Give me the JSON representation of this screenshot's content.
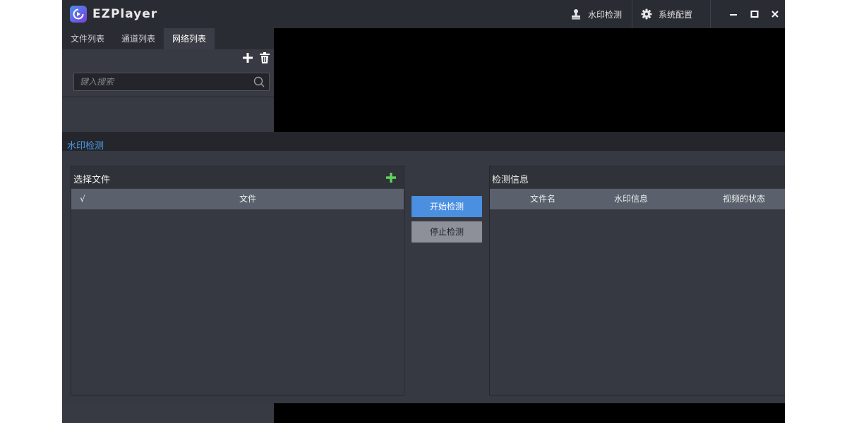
{
  "app": {
    "title": "EZPlayer"
  },
  "titlebar": {
    "watermark_label": "水印检测",
    "settings_label": "系统配置"
  },
  "left_panel": {
    "tabs": [
      {
        "label": "文件列表",
        "active": false
      },
      {
        "label": "通道列表",
        "active": false
      },
      {
        "label": "网络列表",
        "active": true
      }
    ],
    "search": {
      "placeholder": "键入搜索",
      "value": ""
    }
  },
  "dialog": {
    "title": "水印检测",
    "file_panel": {
      "title": "选择文件",
      "columns": [
        "√",
        "文件"
      ]
    },
    "buttons": {
      "start": "开始检测",
      "stop": "停止检测"
    },
    "info_panel": {
      "title": "检测信息",
      "columns": [
        "文件名",
        "水印信息",
        "视频的状态"
      ]
    }
  },
  "colors": {
    "accent": "#4b8fe0",
    "title_link": "#4c9be8",
    "add_icon": "#5fd35a",
    "panel_bg": "#363941",
    "header_bg": "#5a606c"
  }
}
